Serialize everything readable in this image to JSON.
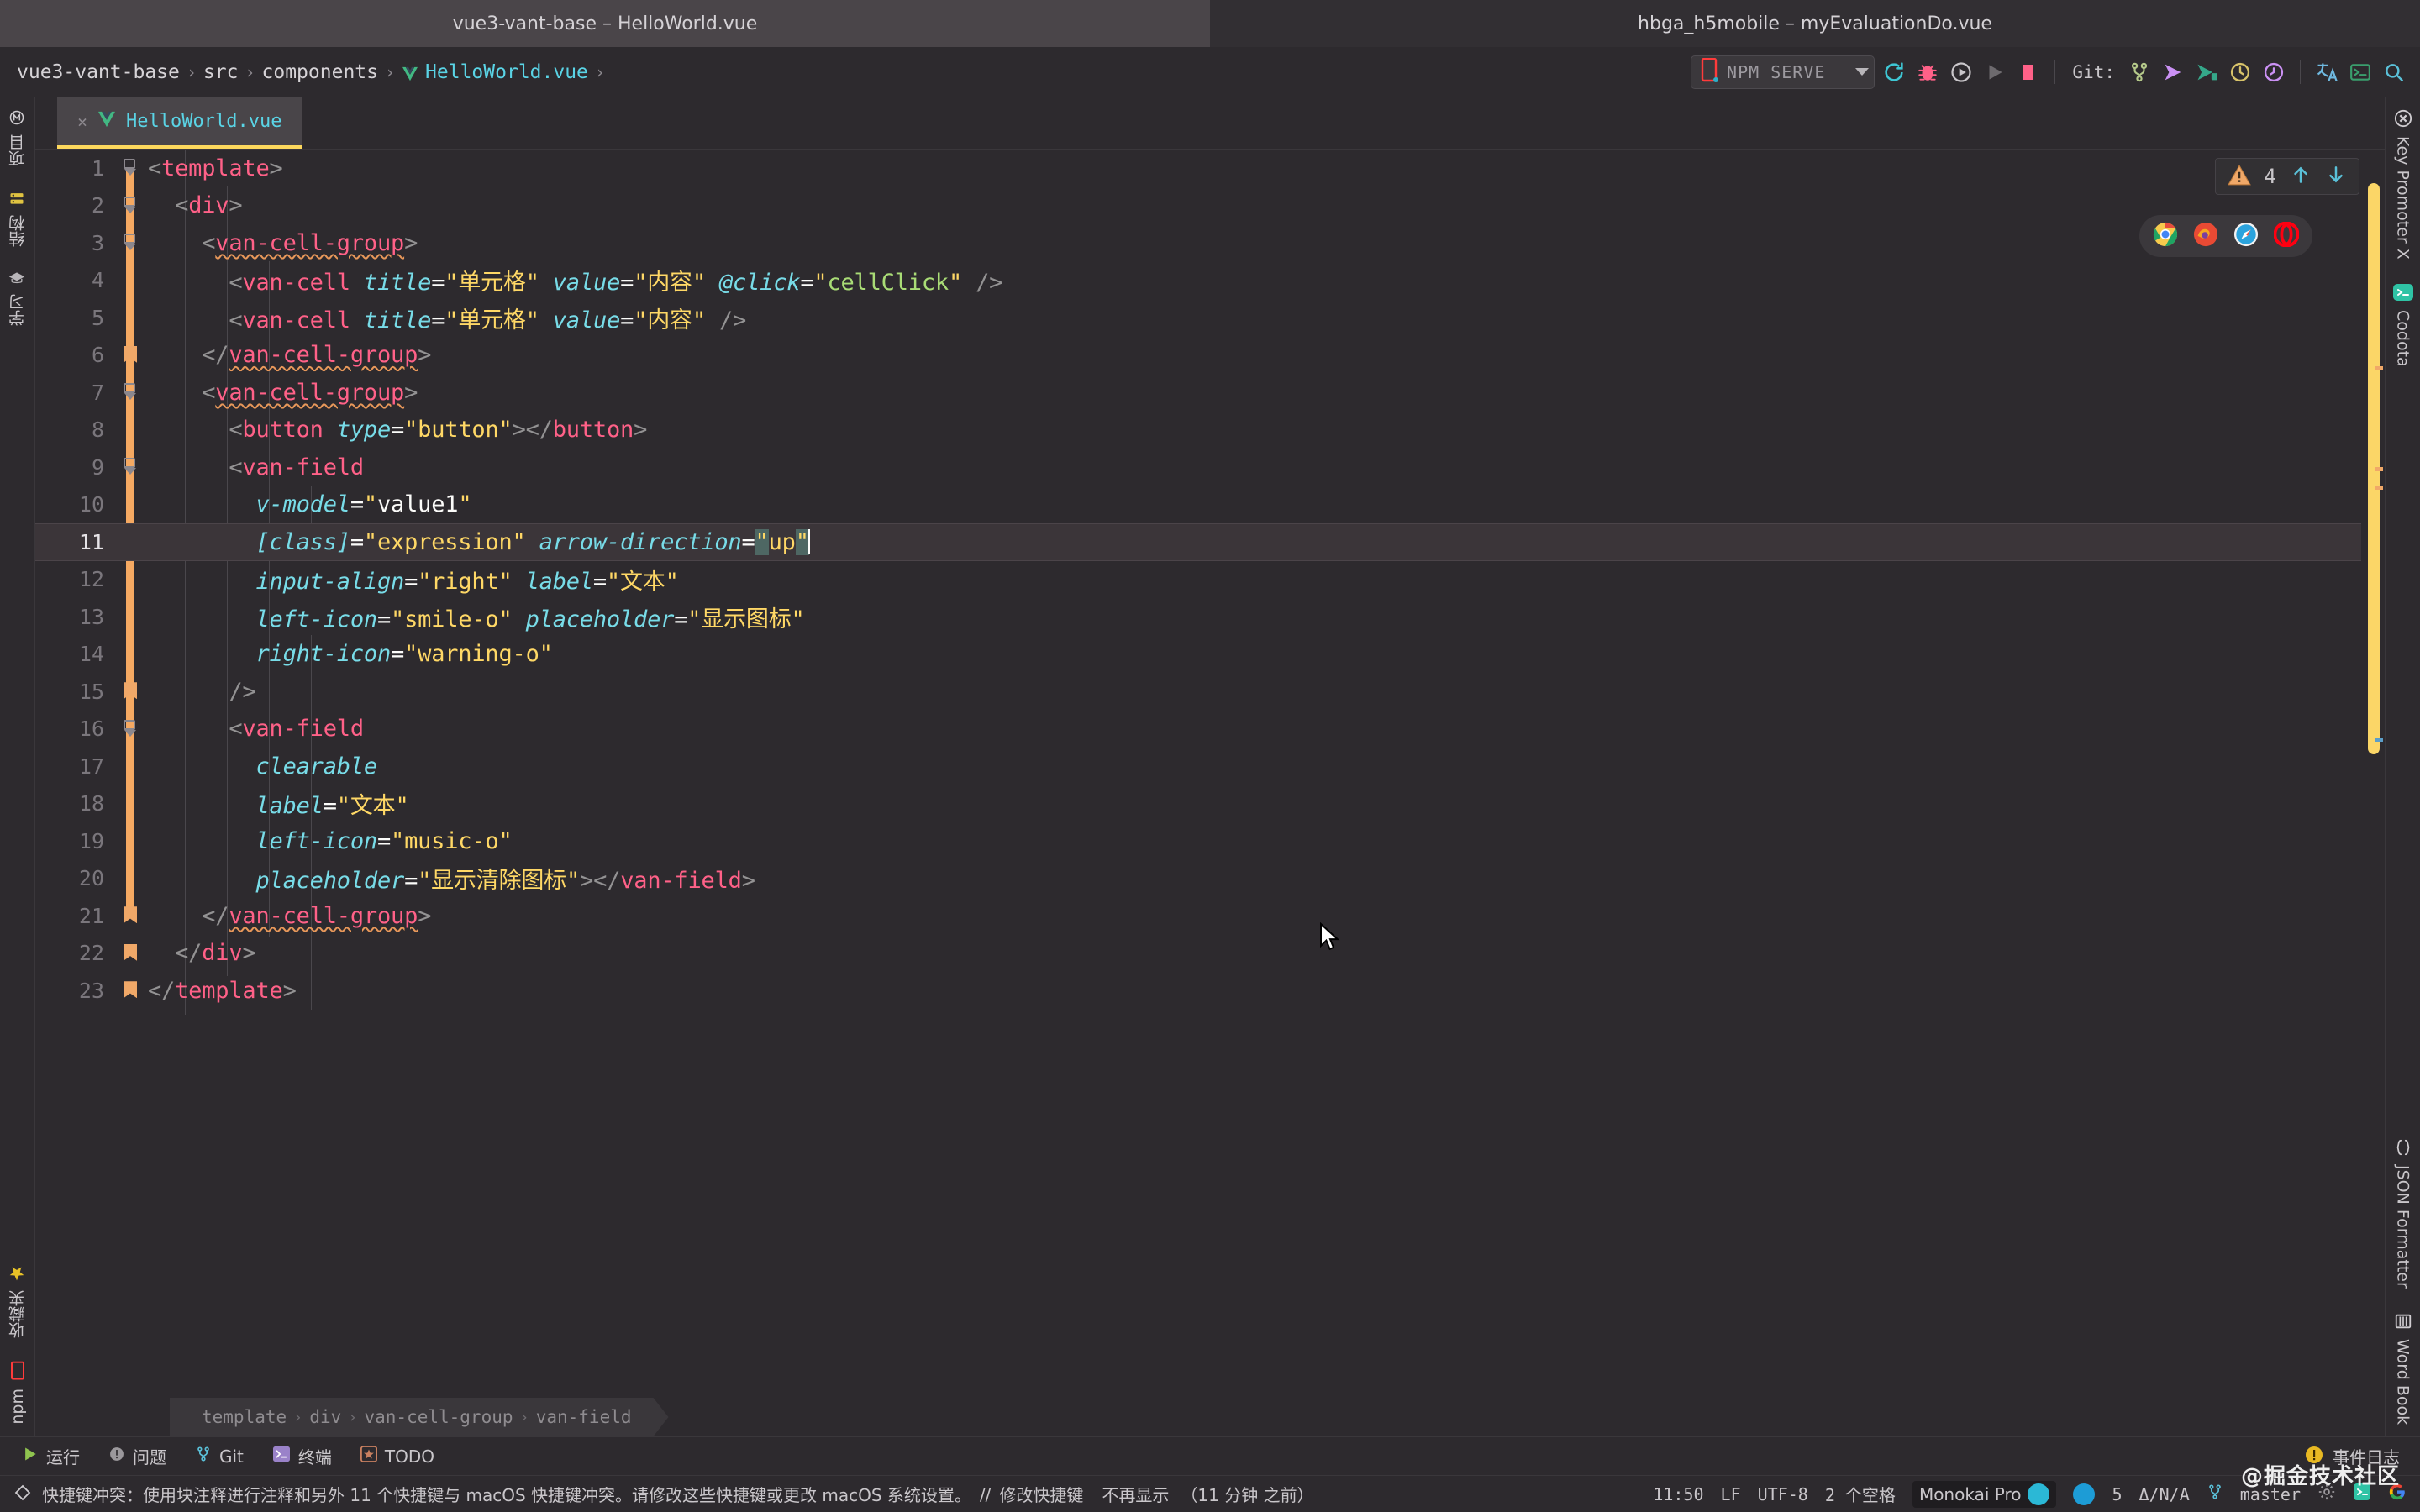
{
  "window": {
    "left_title": "vue3-vant-base – HelloWorld.vue",
    "right_title": "hbga_h5mobile – myEvaluationDo.vue"
  },
  "breadcrumb": {
    "items": [
      "vue3-vant-base",
      "src",
      "components",
      "HelloWorld.vue"
    ],
    "separator": "›",
    "trailing_separator": "›",
    "file_icon": "vue-logo-icon"
  },
  "toolbar": {
    "run_config": "NPM SERVE",
    "git_label": "Git:",
    "icons": [
      "refresh-icon",
      "bug-icon",
      "run-with-coverage-icon",
      "run-icon",
      "stop-icon",
      "git-branch-icon",
      "git-push-icon",
      "git-update-icon",
      "git-history-icon",
      "git-rollback-icon",
      "translate-icon",
      "terminal-icon",
      "search-everywhere-icon"
    ]
  },
  "left_strip": {
    "items": [
      {
        "label": "项目",
        "icon": "project-icon"
      },
      {
        "label": "结构",
        "icon": "structure-icon"
      },
      {
        "label": "学习",
        "icon": "learn-icon"
      }
    ],
    "bottom_items": [
      {
        "label": "收藏夹",
        "icon": "favorites-star-icon"
      },
      {
        "label": "npm",
        "icon": "npm-icon"
      }
    ]
  },
  "right_strip": {
    "items": [
      {
        "label": "Key Promoter X",
        "icon": "key-promoter-icon"
      },
      {
        "label": "Codota",
        "icon": "codota-icon"
      }
    ],
    "bottom_items": [
      {
        "label": "JSON Formatter",
        "icon": "braces-icon"
      },
      {
        "label": "Word Book",
        "icon": "book-icon"
      }
    ]
  },
  "tabs": [
    {
      "label": "HelloWorld.vue",
      "icon": "vue-logo-icon",
      "close": "×",
      "active": true
    }
  ],
  "inspection": {
    "warning_count": "4",
    "icon": "warning-triangle-icon",
    "up": "↑",
    "down": "↓"
  },
  "browsers": [
    "chrome-icon",
    "firefox-icon",
    "safari-icon",
    "opera-icon"
  ],
  "editor": {
    "current_line": 11,
    "lines": [
      {
        "n": "1",
        "indent": 0,
        "tokens": [
          {
            "t": "br",
            "v": "<"
          },
          {
            "t": "tag",
            "v": "template"
          },
          {
            "t": "br",
            "v": ">"
          }
        ],
        "fold": "open"
      },
      {
        "n": "2",
        "indent": 1,
        "tokens": [
          {
            "t": "br",
            "v": "<"
          },
          {
            "t": "tag",
            "v": "div"
          },
          {
            "t": "br",
            "v": ">"
          }
        ],
        "fold": "open",
        "change": true
      },
      {
        "n": "3",
        "indent": 2,
        "tokens": [
          {
            "t": "br",
            "v": "<"
          },
          {
            "t": "tag",
            "v": "van-cell-group",
            "wavy": true
          },
          {
            "t": "br",
            "v": ">"
          }
        ],
        "fold": "open",
        "change": true
      },
      {
        "n": "4",
        "indent": 3,
        "tokens": [
          {
            "t": "br",
            "v": "<"
          },
          {
            "t": "tag",
            "v": "van-cell"
          },
          {
            "t": "plain",
            "v": " "
          },
          {
            "t": "attr",
            "v": "title"
          },
          {
            "t": "eq",
            "v": "="
          },
          {
            "t": "str",
            "v": "\"单元格\""
          },
          {
            "t": "plain",
            "v": " "
          },
          {
            "t": "attr",
            "v": "value"
          },
          {
            "t": "eq",
            "v": "="
          },
          {
            "t": "str",
            "v": "\"内容\""
          },
          {
            "t": "plain",
            "v": " "
          },
          {
            "t": "attr",
            "v": "@click"
          },
          {
            "t": "eq",
            "v": "="
          },
          {
            "t": "str",
            "v": "\""
          },
          {
            "t": "expr",
            "v": "cellClick"
          },
          {
            "t": "str",
            "v": "\""
          },
          {
            "t": "plain",
            "v": " "
          },
          {
            "t": "br",
            "v": "/>"
          }
        ],
        "change": true
      },
      {
        "n": "5",
        "indent": 3,
        "tokens": [
          {
            "t": "br",
            "v": "<"
          },
          {
            "t": "tag",
            "v": "van-cell"
          },
          {
            "t": "plain",
            "v": " "
          },
          {
            "t": "attr",
            "v": "title"
          },
          {
            "t": "eq",
            "v": "="
          },
          {
            "t": "str",
            "v": "\"单元格\""
          },
          {
            "t": "plain",
            "v": " "
          },
          {
            "t": "attr",
            "v": "value"
          },
          {
            "t": "eq",
            "v": "="
          },
          {
            "t": "str",
            "v": "\"内容\""
          },
          {
            "t": "plain",
            "v": " "
          },
          {
            "t": "br",
            "v": "/>"
          }
        ],
        "change": true
      },
      {
        "n": "6",
        "indent": 2,
        "tokens": [
          {
            "t": "br",
            "v": "</"
          },
          {
            "t": "tag",
            "v": "van-cell-group",
            "wavy": true
          },
          {
            "t": "br",
            "v": ">"
          }
        ],
        "fold": "close",
        "change": true
      },
      {
        "n": "7",
        "indent": 2,
        "tokens": [
          {
            "t": "br",
            "v": "<"
          },
          {
            "t": "tag",
            "v": "van-cell-group",
            "wavy": true
          },
          {
            "t": "br",
            "v": ">"
          }
        ],
        "fold": "open",
        "change": true
      },
      {
        "n": "8",
        "indent": 3,
        "tokens": [
          {
            "t": "br",
            "v": "<"
          },
          {
            "t": "tag",
            "v": "button"
          },
          {
            "t": "plain",
            "v": " "
          },
          {
            "t": "attr",
            "v": "type"
          },
          {
            "t": "eq",
            "v": "="
          },
          {
            "t": "str",
            "v": "\"button\""
          },
          {
            "t": "br",
            "v": "></"
          },
          {
            "t": "tag",
            "v": "button"
          },
          {
            "t": "br",
            "v": ">"
          }
        ],
        "change": true
      },
      {
        "n": "9",
        "indent": 3,
        "tokens": [
          {
            "t": "br",
            "v": "<"
          },
          {
            "t": "tag",
            "v": "van-field"
          }
        ],
        "fold": "open",
        "change": true
      },
      {
        "n": "10",
        "indent": 4,
        "tokens": [
          {
            "t": "attr",
            "v": "v-model"
          },
          {
            "t": "eq",
            "v": "="
          },
          {
            "t": "str",
            "v": "\""
          },
          {
            "t": "plain",
            "v": "value1"
          },
          {
            "t": "str",
            "v": "\""
          }
        ],
        "change": true
      },
      {
        "n": "11",
        "indent": 4,
        "tokens": [
          {
            "t": "attr",
            "v": "[class]"
          },
          {
            "t": "eq",
            "v": "="
          },
          {
            "t": "str",
            "v": "\"expression\""
          },
          {
            "t": "plain",
            "v": " "
          },
          {
            "t": "attr",
            "v": "arrow-direction"
          },
          {
            "t": "eq",
            "v": "="
          },
          {
            "t": "str",
            "v": "\"",
            "sel": true
          },
          {
            "t": "str",
            "v": "up"
          },
          {
            "t": "str",
            "v": "\"",
            "sel": true
          },
          {
            "t": "caret",
            "v": ""
          }
        ],
        "current": true,
        "change": true
      },
      {
        "n": "12",
        "indent": 4,
        "tokens": [
          {
            "t": "attr",
            "v": "input-align"
          },
          {
            "t": "eq",
            "v": "="
          },
          {
            "t": "str",
            "v": "\"right\""
          },
          {
            "t": "plain",
            "v": " "
          },
          {
            "t": "attr",
            "v": "label"
          },
          {
            "t": "eq",
            "v": "="
          },
          {
            "t": "str",
            "v": "\"文本\""
          }
        ],
        "change": true
      },
      {
        "n": "13",
        "indent": 4,
        "tokens": [
          {
            "t": "attr",
            "v": "left-icon"
          },
          {
            "t": "eq",
            "v": "="
          },
          {
            "t": "str",
            "v": "\"smile-o\""
          },
          {
            "t": "plain",
            "v": " "
          },
          {
            "t": "attr",
            "v": "placeholder"
          },
          {
            "t": "eq",
            "v": "="
          },
          {
            "t": "str",
            "v": "\"显示图标\""
          }
        ],
        "change": true
      },
      {
        "n": "14",
        "indent": 4,
        "tokens": [
          {
            "t": "attr",
            "v": "right-icon"
          },
          {
            "t": "eq",
            "v": "="
          },
          {
            "t": "str",
            "v": "\"warning-o\""
          }
        ],
        "change": true
      },
      {
        "n": "15",
        "indent": 3,
        "tokens": [
          {
            "t": "br",
            "v": "/>"
          }
        ],
        "fold": "close",
        "change": true
      },
      {
        "n": "16",
        "indent": 3,
        "tokens": [
          {
            "t": "br",
            "v": "<"
          },
          {
            "t": "tag",
            "v": "van-field"
          }
        ],
        "fold": "open",
        "change": true
      },
      {
        "n": "17",
        "indent": 4,
        "tokens": [
          {
            "t": "attr",
            "v": "clearable"
          }
        ],
        "change": true
      },
      {
        "n": "18",
        "indent": 4,
        "tokens": [
          {
            "t": "attr",
            "v": "label"
          },
          {
            "t": "eq",
            "v": "="
          },
          {
            "t": "str",
            "v": "\"文本\""
          }
        ],
        "change": true
      },
      {
        "n": "19",
        "indent": 4,
        "tokens": [
          {
            "t": "attr",
            "v": "left-icon"
          },
          {
            "t": "eq",
            "v": "="
          },
          {
            "t": "str",
            "v": "\"music-o\""
          }
        ],
        "change": true
      },
      {
        "n": "20",
        "indent": 4,
        "tokens": [
          {
            "t": "attr",
            "v": "placeholder"
          },
          {
            "t": "eq",
            "v": "="
          },
          {
            "t": "str",
            "v": "\"显示清除图标\""
          },
          {
            "t": "br",
            "v": "></"
          },
          {
            "t": "tag",
            "v": "van-field"
          },
          {
            "t": "br",
            "v": ">"
          }
        ],
        "change": true
      },
      {
        "n": "21",
        "indent": 2,
        "tokens": [
          {
            "t": "br",
            "v": "</"
          },
          {
            "t": "tag",
            "v": "van-cell-group",
            "wavy": true
          },
          {
            "t": "br",
            "v": ">"
          }
        ],
        "fold": "close",
        "change": true
      },
      {
        "n": "22",
        "indent": 1,
        "tokens": [
          {
            "t": "br",
            "v": "</"
          },
          {
            "t": "tag",
            "v": "div"
          },
          {
            "t": "br",
            "v": ">"
          }
        ],
        "fold": "close"
      },
      {
        "n": "23",
        "indent": 0,
        "tokens": [
          {
            "t": "br",
            "v": "</"
          },
          {
            "t": "tag",
            "v": "template"
          },
          {
            "t": "br",
            "v": ">"
          }
        ],
        "fold": "close"
      }
    ]
  },
  "editor_breadcrumb": {
    "items": [
      "template",
      "div",
      "van-cell-group",
      "van-field"
    ],
    "separator": "›"
  },
  "tool_window_bar": {
    "items": [
      {
        "label": "运行",
        "icon": "run-icon"
      },
      {
        "label": "问题",
        "icon": "problems-icon"
      },
      {
        "label": "Git",
        "icon": "git-icon"
      },
      {
        "label": "终端",
        "icon": "terminal-icon"
      },
      {
        "label": "TODO",
        "icon": "todo-icon"
      }
    ],
    "right": [
      {
        "label": "事件日志",
        "icon": "event-log-warning-icon"
      }
    ]
  },
  "status_bar": {
    "message": "快捷键冲突：使用块注释进行注释和另外 11 个快捷键与 macOS 快捷键冲突。请修改这些快捷键或更改 macOS 系统设置。",
    "link_sep": "//",
    "link1": "修改快捷键",
    "link2": "不再显示",
    "timestamp": "（11 分钟 之前）",
    "caret_icon": "info-diamond-icon",
    "time": "11:50",
    "line_sep": "LF",
    "encoding": "UTF-8",
    "indent": "2 个空格",
    "scheme": "Monokai Pro",
    "inspection_count": "5",
    "inspection_detail": "Δ/N/A",
    "branch": "master",
    "branch_icon": "git-branch-icon",
    "watermark": "@掘金技术社区"
  },
  "colors": {
    "bg": "#2d2a2e",
    "titlebar_active": "#4a4549",
    "titlebar_inactive": "#322f33",
    "tag": "#ff6188",
    "attribute": "#78dce8",
    "string": "#ffd866",
    "expression": "#a9dc76",
    "bracket": "#939293",
    "change_bar": "#f5a962",
    "tab_underline": "#fdd85d",
    "scrollbar": "#fbd667",
    "warning": "#f0a868"
  }
}
